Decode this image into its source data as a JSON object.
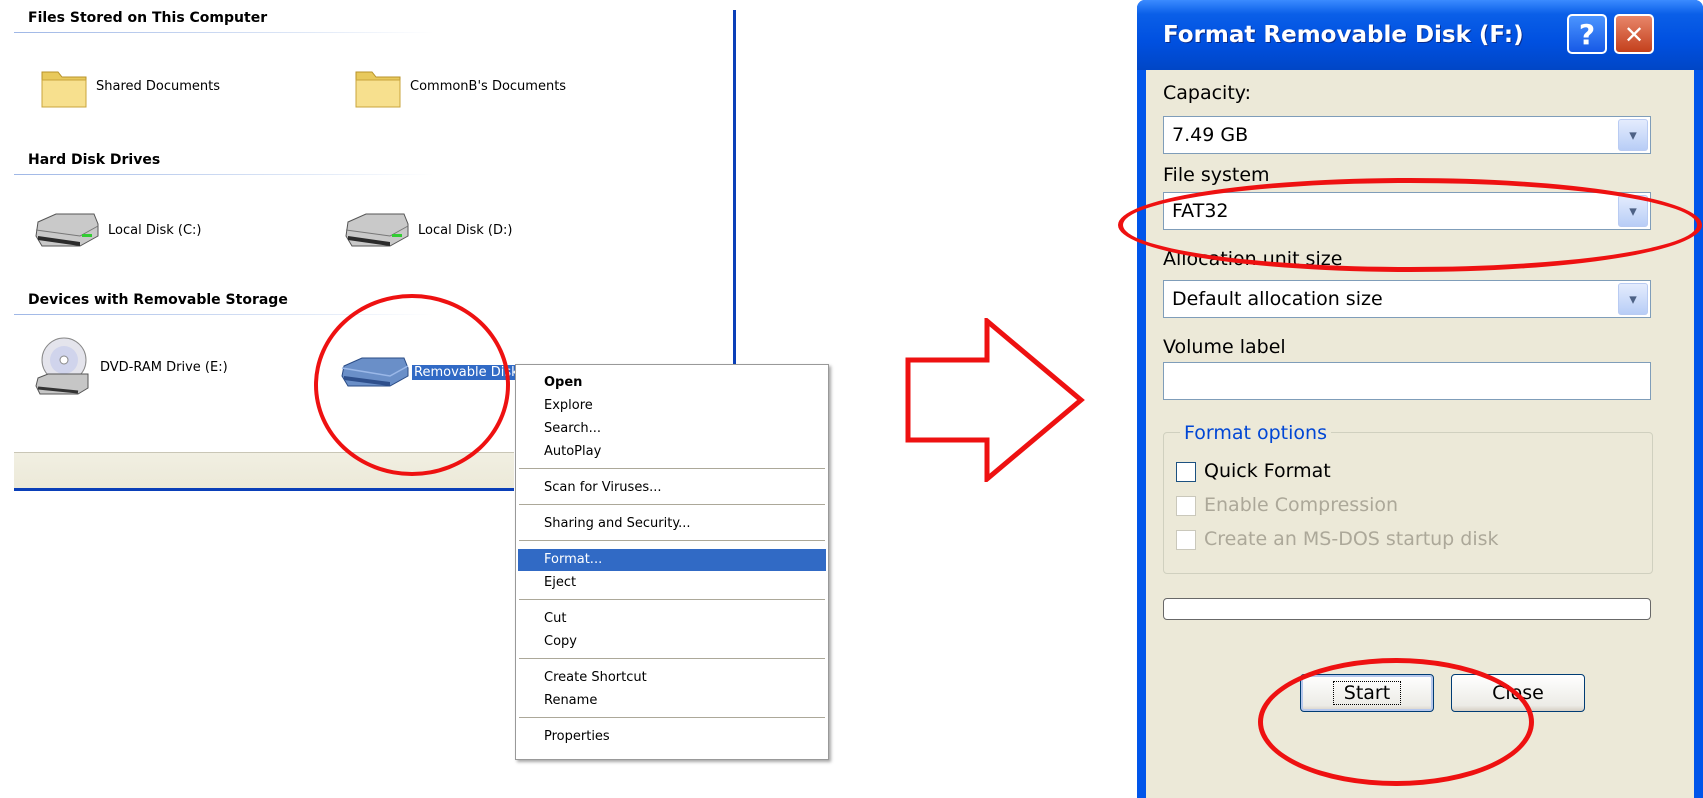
{
  "explorer": {
    "sections": [
      {
        "title": "Files Stored on This Computer",
        "items": [
          {
            "label": "Shared Documents",
            "icon": "folder-icon"
          },
          {
            "label": "CommonB's Documents",
            "icon": "folder-icon"
          }
        ]
      },
      {
        "title": "Hard Disk Drives",
        "items": [
          {
            "label": "Local Disk (C:)",
            "icon": "hard-disk-icon"
          },
          {
            "label": "Local Disk (D:)",
            "icon": "hard-disk-icon"
          }
        ]
      },
      {
        "title": "Devices with Removable Storage",
        "items": [
          {
            "label": "DVD-RAM Drive (E:)",
            "icon": "dvd-drive-icon"
          },
          {
            "label": "Removable Disk (F:)",
            "icon": "removable-disk-icon",
            "selected": true
          }
        ]
      }
    ]
  },
  "context_menu": {
    "items": [
      "Open",
      "Explore",
      "Search...",
      "AutoPlay",
      "Scan for Viruses...",
      "Sharing and Security...",
      "Format...",
      "Eject",
      "Cut",
      "Copy",
      "Create Shortcut",
      "Rename",
      "Properties"
    ],
    "highlighted": "Format..."
  },
  "dialog": {
    "title": "Format Removable Disk (F:)",
    "help_glyph": "?",
    "close_glyph": "✕",
    "capacity_label": "Capacity:",
    "capacity_value": "7.49 GB",
    "filesystem_label": "File system",
    "filesystem_value": "FAT32",
    "allocation_label": "Allocation unit size",
    "allocation_value": "Default allocation size",
    "volume_label": "Volume label",
    "volume_value": "",
    "format_options_label": "Format options",
    "quick_format_label": "Quick Format",
    "enable_compression_label": "Enable Compression",
    "msdos_label": "Create an MS-DOS startup disk",
    "start_label": "Start",
    "close_label": "Close",
    "dropdown_glyph": "▾"
  },
  "colors": {
    "annotation": "#ee1111",
    "selection": "#316ac5",
    "title_bar": "#0055ea"
  }
}
